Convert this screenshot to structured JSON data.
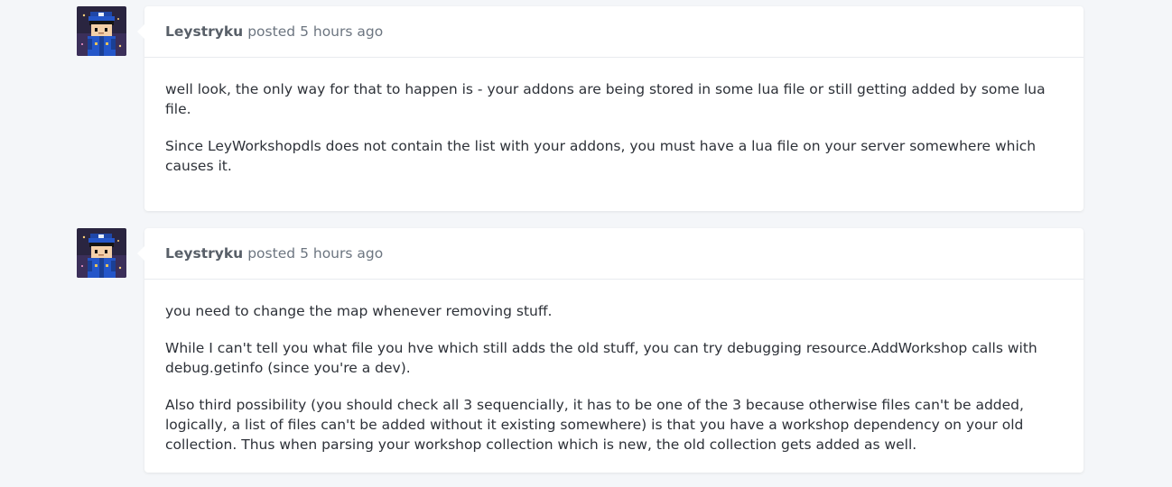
{
  "posts": [
    {
      "author": "Leystryku",
      "verb": "posted",
      "time": "5 hours ago",
      "paragraphs": [
        "well look, the only way for that to happen is - your addons are being stored in some lua file or still getting added by some lua file.",
        "Since LeyWorkshopdls does not contain the list with your addons, you must have a lua file on your server somewhere which causes it."
      ]
    },
    {
      "author": "Leystryku",
      "verb": "posted",
      "time": "5 hours ago",
      "paragraphs": [
        "you need to change the map whenever removing stuff.",
        "While I can't tell you what file you hve which still adds the old stuff, you can try debugging resource.AddWorkshop calls with debug.getinfo (since you're a dev).",
        "Also third possibility (you should check all 3 sequencially, it has to be one of the 3 because otherwise files can't be added, logically, a list of files can't be added without it existing somewhere) is that you have a workshop dependency on your old collection. Thus when parsing your workshop collection which is new, the old collection gets added as well."
      ]
    }
  ],
  "avatar_icon": "pixel-art-character-avatar",
  "colors": {
    "background": "#f4f6f9",
    "card": "#ffffff",
    "author": "#585f68",
    "meta": "#6c7580",
    "text": "#2d3138"
  }
}
